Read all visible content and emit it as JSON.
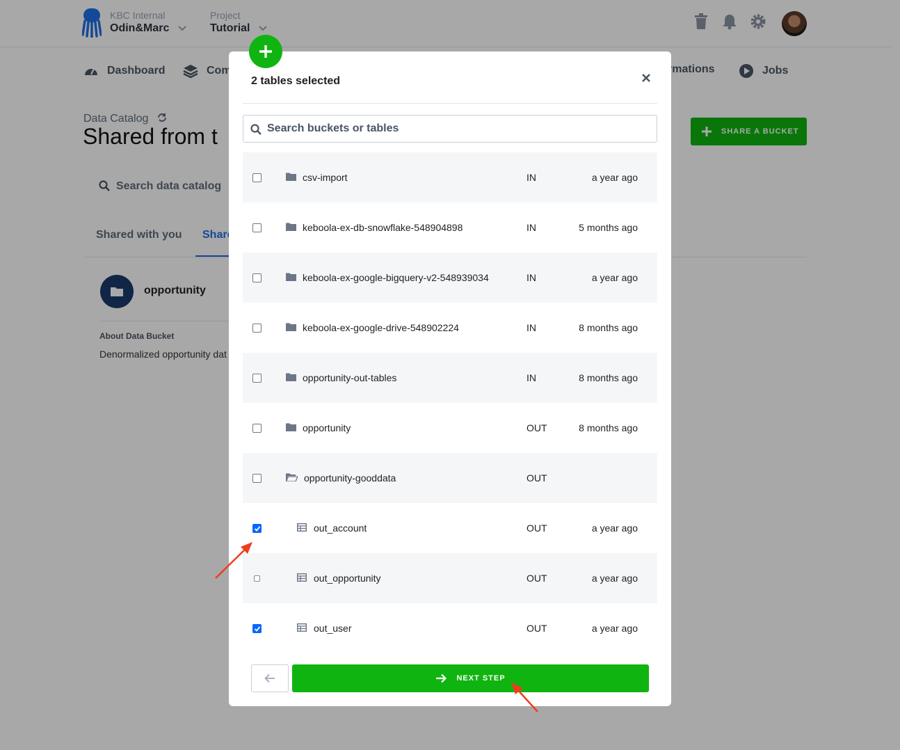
{
  "header": {
    "org_label": "KBC Internal",
    "org_name": "Odin&Marc",
    "project_label": "Project",
    "project_name": "Tutorial"
  },
  "nav": {
    "dashboard": "Dashboard",
    "components_partial": "Com",
    "transformations_partial": "rmations",
    "jobs": "Jobs"
  },
  "page": {
    "subtitle": "Data Catalog",
    "title_partial": "Shared from t",
    "share_button": "SHARE A BUCKET",
    "search_placeholder": "Search data catalog",
    "tab_shared_with_you": "Shared with you",
    "tab_shared_partial": "Share",
    "bucket_name": "opportunity",
    "about_label": "About Data Bucket",
    "about_text_partial": "Denormalized opportunity dat"
  },
  "modal": {
    "title": "2 tables selected",
    "search_placeholder": "Search buckets or tables",
    "next_label": "NEXT STEP",
    "rows": [
      {
        "name": "csv-import",
        "stage": "IN",
        "time": "a year ago",
        "checked": false
      },
      {
        "name": "keboola-ex-db-snowflake-548904898",
        "stage": "IN",
        "time": "5 months ago",
        "checked": false
      },
      {
        "name": "keboola-ex-google-bigquery-v2-548939034",
        "stage": "IN",
        "time": "a year ago",
        "checked": false
      },
      {
        "name": "keboola-ex-google-drive-548902224",
        "stage": "IN",
        "time": "8 months ago",
        "checked": false
      },
      {
        "name": "opportunity-out-tables",
        "stage": "IN",
        "time": "8 months ago",
        "checked": false
      },
      {
        "name": "opportunity",
        "stage": "OUT",
        "time": "8 months ago",
        "checked": false
      },
      {
        "name": "opportunity-gooddata",
        "stage": "OUT",
        "time": "",
        "checked": false
      },
      {
        "name": "out_account",
        "stage": "OUT",
        "time": "a year ago",
        "checked": true
      },
      {
        "name": "out_opportunity",
        "stage": "OUT",
        "time": "a year ago",
        "checked": false
      },
      {
        "name": "out_user",
        "stage": "OUT",
        "time": "a year ago",
        "checked": true
      }
    ]
  },
  "colors": {
    "accent_green": "#10b410",
    "checkbox_blue": "#0a66ff",
    "annotation_red": "#f03c1e",
    "brand_blue": "#1f6fe5"
  }
}
